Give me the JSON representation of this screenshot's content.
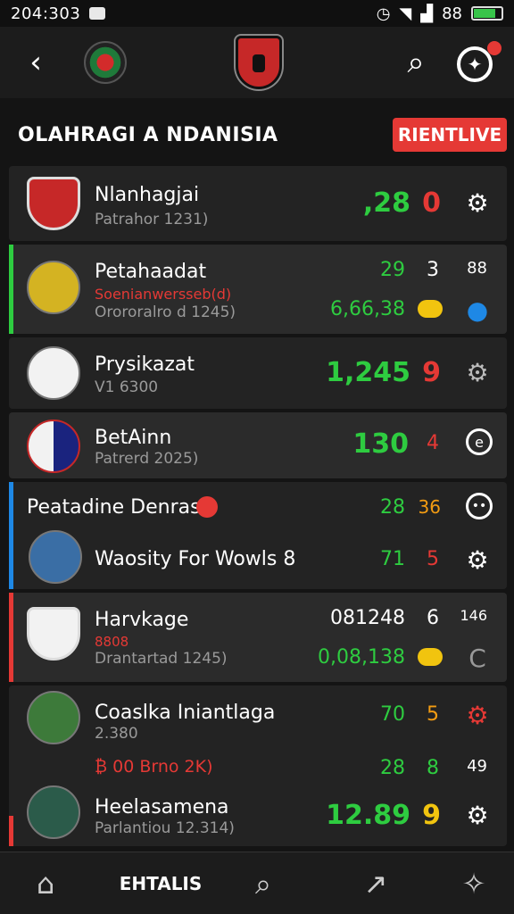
{
  "status": {
    "time": "204:303",
    "battery_text": "88"
  },
  "header": {
    "back": "‹",
    "search": "⌕"
  },
  "section": {
    "title": "OLAHRAGI A NDANISIA",
    "live_button": "RIENTLIVE"
  },
  "colors": {
    "accent_red": "#e53935",
    "accent_green": "#2ecc40",
    "accent_blue": "#1e88e5"
  },
  "rows": [
    {
      "name": "Nlanhagjai",
      "sub": "Patrahor 1231)",
      "v1": ",28",
      "v2": "0"
    },
    {
      "name": "Petahaadat",
      "sub_red": "Soenianwersseb(d)",
      "sub": "Orororalro d 1245)",
      "v1": "29",
      "v2": "3",
      "v3": "88",
      "v4": "6,66,38"
    },
    {
      "name": "Prysikazat",
      "sub": "V1 6300",
      "v1": "1,245",
      "v2": "9"
    },
    {
      "name": "BetAinn",
      "sub": "Patrerd 2025)",
      "v1": "130",
      "v2": "4"
    },
    {
      "name": "Peatadine Denrast",
      "name2": "Waosity For Wowls 8",
      "v1": "28",
      "v2": "36",
      "v3": "71",
      "v4": "5"
    },
    {
      "name": "Harvkage",
      "sub_red": "8808",
      "sub": "Drantartad 1245)",
      "v1": "081248",
      "v2": "6",
      "v3": "146",
      "v4": "0,08,138"
    },
    {
      "name": "Coaslka Iniantlaga",
      "sub": "2.380",
      "v1": "70",
      "v2": "5",
      "promo": "₿ 00 Brno 2K)",
      "v3": "28",
      "v4": "8",
      "v5": "49"
    },
    {
      "name": "Heelasamena",
      "sub": "Parlantiou 12.314)",
      "v1": "12.89",
      "v2": "9"
    }
  ],
  "bottom_nav": {
    "label": "EHTALIS"
  }
}
